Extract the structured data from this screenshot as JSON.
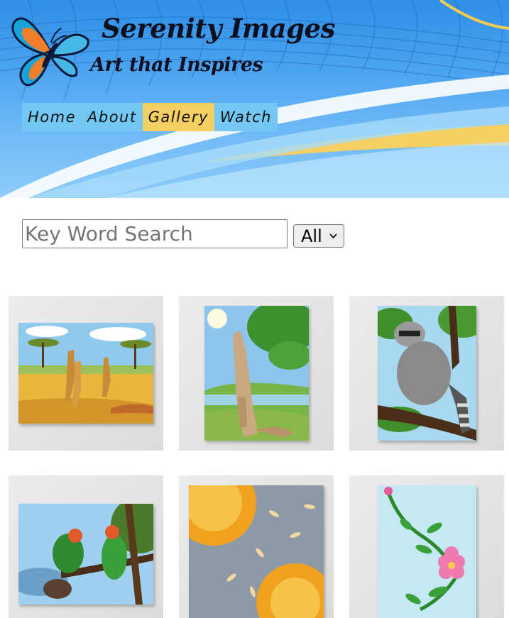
{
  "site": {
    "title": "Serenity Images",
    "tagline": "Art that Inspires"
  },
  "nav": {
    "items": [
      {
        "label": "Home",
        "active": false
      },
      {
        "label": "About",
        "active": false
      },
      {
        "label": "Gallery",
        "active": true
      },
      {
        "label": "Watch",
        "active": false
      }
    ]
  },
  "search": {
    "placeholder": "Key Word Search",
    "value": "",
    "category": "All"
  },
  "gallery": {
    "items": [
      {
        "subject": "giraffes"
      },
      {
        "subject": "kangaroo"
      },
      {
        "subject": "raccoon"
      },
      {
        "subject": "parrots"
      },
      {
        "subject": "sunflowers"
      },
      {
        "subject": "pink-flower"
      }
    ]
  },
  "colors": {
    "nav_bg": "#73c7f4",
    "nav_active": "#f6cf63",
    "banner_blue": "#2f8fe6"
  }
}
